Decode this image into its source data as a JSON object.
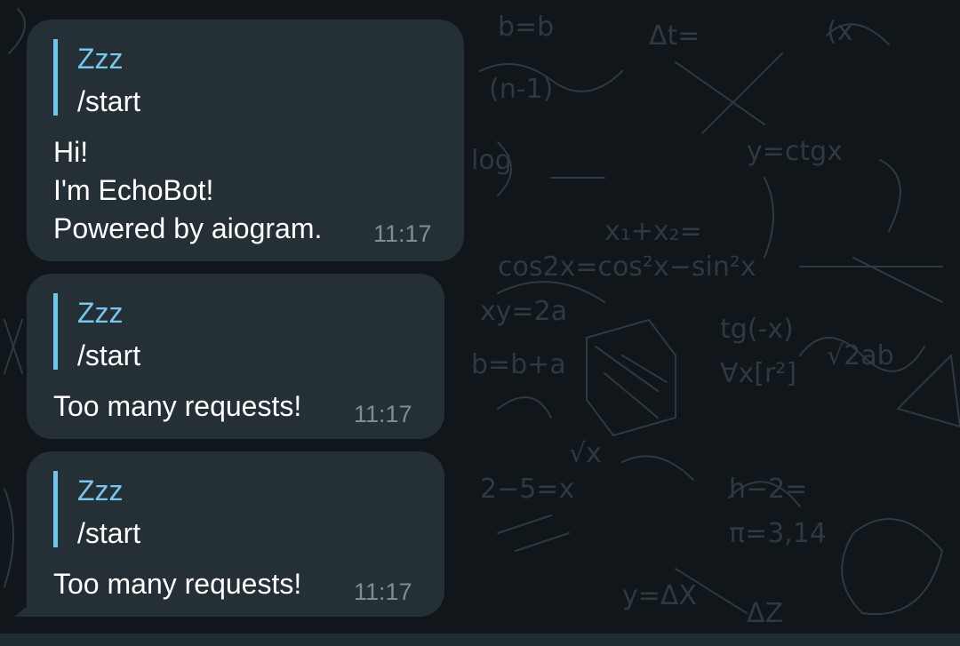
{
  "colors": {
    "bubble": "#252f36",
    "accent": "#78c7ee",
    "time": "#838c93",
    "background": "#101619"
  },
  "messages": [
    {
      "reply_author": "Zzz",
      "reply_text": "/start",
      "text": "Hi!\nI'm EchoBot!\nPowered by aiogram.",
      "time": "11:17"
    },
    {
      "reply_author": "Zzz",
      "reply_text": "/start",
      "text": "Too many requests!",
      "time": "11:17"
    },
    {
      "reply_author": "Zzz",
      "reply_text": "/start",
      "text": "Too many requests!",
      "time": "11:17"
    }
  ]
}
